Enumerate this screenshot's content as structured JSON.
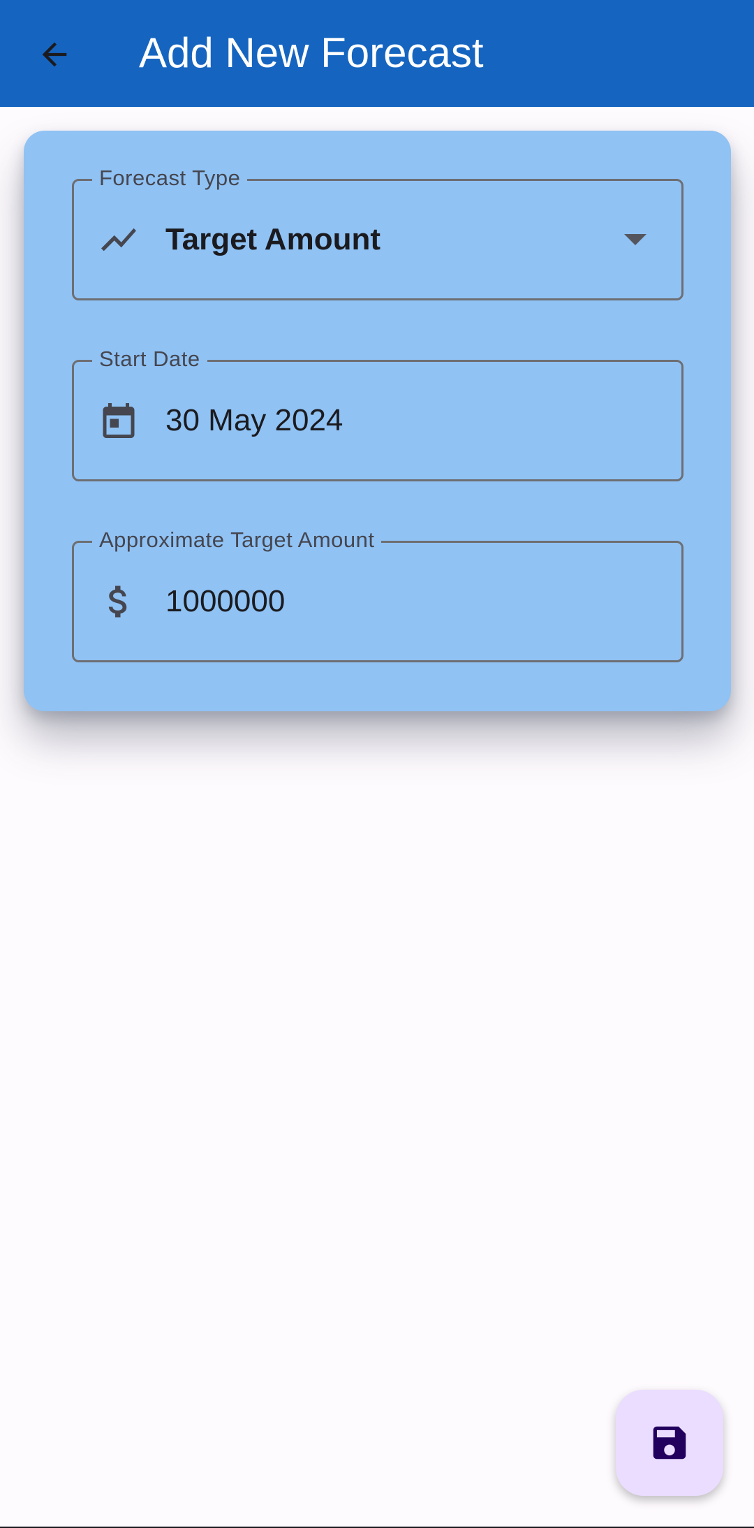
{
  "app_bar": {
    "title": "Add New Forecast",
    "back_icon": "arrow-back-icon",
    "background_color": "#1565c0"
  },
  "form": {
    "card_color": "#90c2f4",
    "forecast_type": {
      "label": "Forecast Type",
      "value": "Target Amount",
      "icon": "trending-up-icon"
    },
    "start_date": {
      "label": "Start Date",
      "value": "30 May 2024",
      "icon": "calendar-icon"
    },
    "target_amount": {
      "label": "Approximate Target Amount",
      "value": "1000000",
      "icon": "dollar-icon"
    }
  },
  "fab": {
    "icon": "save-icon",
    "background_color": "#eaddff"
  }
}
